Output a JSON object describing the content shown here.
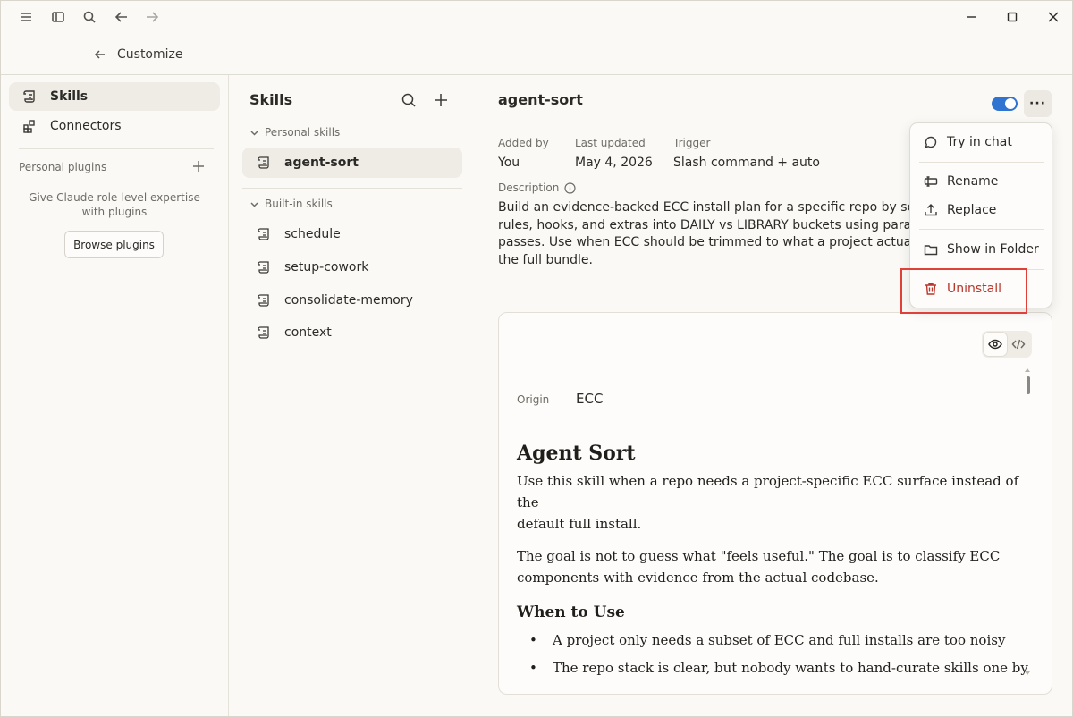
{
  "header": {
    "back_label": "Customize"
  },
  "sidebar": {
    "nav": [
      {
        "label": "Skills",
        "icon": "scroll-icon",
        "active": true
      },
      {
        "label": "Connectors",
        "icon": "connectors-icon",
        "active": false
      }
    ],
    "personal_plugins_label": "Personal plugins",
    "personal_plugins_desc": "Give Claude role-level expertise\nwith plugins",
    "browse_label": "Browse plugins"
  },
  "skills_panel": {
    "title": "Skills",
    "personal_header": "Personal skills",
    "personal": [
      "agent-sort"
    ],
    "builtin_header": "Built-in skills",
    "builtin": [
      "schedule",
      "setup-cowork",
      "consolidate-memory",
      "context"
    ]
  },
  "detail": {
    "title": "agent-sort",
    "enabled": true,
    "meta": {
      "added_by_label": "Added by",
      "added_by": "You",
      "updated_label": "Last updated",
      "updated": "May 4, 2026",
      "trigger_label": "Trigger",
      "trigger": "Slash command + auto"
    },
    "description_label": "Description",
    "description": "Build an evidence-backed ECC install plan for a specific repo by sorting\nrules, hooks, and extras into DAILY vs LIBRARY buckets using parallel r\npasses. Use when ECC should be trimmed to what a project actually ne\nthe full bundle.",
    "origin_label": "Origin",
    "origin": "ECC",
    "doc": {
      "h1": "Agent Sort",
      "p1a": "Use this skill when a repo needs a project-specific ECC surface instead of the",
      "p1b": "default full install.",
      "p2a": "The goal is not to guess what \"feels useful.\" The goal is to classify ECC",
      "p2b": "components with evidence from the actual codebase.",
      "h2": "When to Use",
      "bullets": [
        "A project only needs a subset of ECC and full installs are too noisy",
        "The repo stack is clear, but nobody wants to hand-curate skills one by"
      ]
    }
  },
  "menu": {
    "items": [
      {
        "label": "Try in chat",
        "icon": "chat-bubble-icon"
      },
      {
        "label": "Rename",
        "icon": "rename-icon"
      },
      {
        "label": "Replace",
        "icon": "upload-icon"
      },
      {
        "label": "Show in Folder",
        "icon": "folder-icon"
      },
      {
        "label": "Uninstall",
        "icon": "trash-icon"
      }
    ]
  },
  "colors": {
    "accent": "#2f74d0",
    "danger": "#b9362c",
    "highlight": "#e0403a"
  }
}
